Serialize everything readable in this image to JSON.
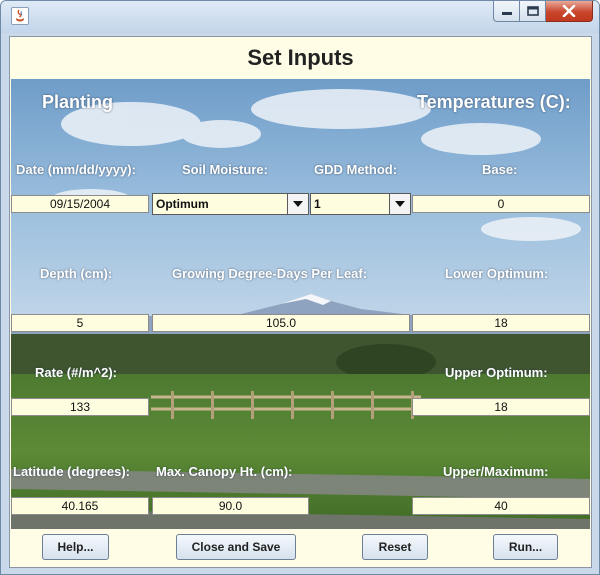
{
  "window": {
    "app_icon": "java-icon",
    "buttons": {
      "minimize": "minimize-icon",
      "maximize": "maximize-icon",
      "close": "close-icon"
    }
  },
  "dialog": {
    "title": "Set Inputs",
    "sections": {
      "planting": "Planting",
      "temperatures": "Temperatures (C):"
    },
    "labels": {
      "date": "Date (mm/dd/yyyy):",
      "soil_moisture": "Soil Moisture:",
      "gdd_method": "GDD Method:",
      "base": "Base:",
      "depth": "Depth (cm):",
      "gdd_per_leaf": "Growing Degree-Days Per Leaf:",
      "lower_optimum": "Lower Optimum:",
      "rate": "Rate (#/m^2):",
      "upper_optimum": "Upper Optimum:",
      "latitude": "Latitude (degrees):",
      "max_canopy": "Max. Canopy Ht. (cm):",
      "upper_maximum": "Upper/Maximum:"
    },
    "values": {
      "date": "09/15/2004",
      "soil_moisture": "Optimum",
      "gdd_method": "1",
      "base": "0",
      "depth": "5",
      "gdd_per_leaf": "105.0",
      "lower_optimum": "18",
      "rate": "133",
      "upper_optimum": "18",
      "latitude": "40.165",
      "max_canopy": "90.0",
      "upper_maximum": "40"
    },
    "buttons": {
      "help": "Help...",
      "close_save": "Close and Save",
      "reset": "Reset",
      "run": "Run..."
    }
  }
}
